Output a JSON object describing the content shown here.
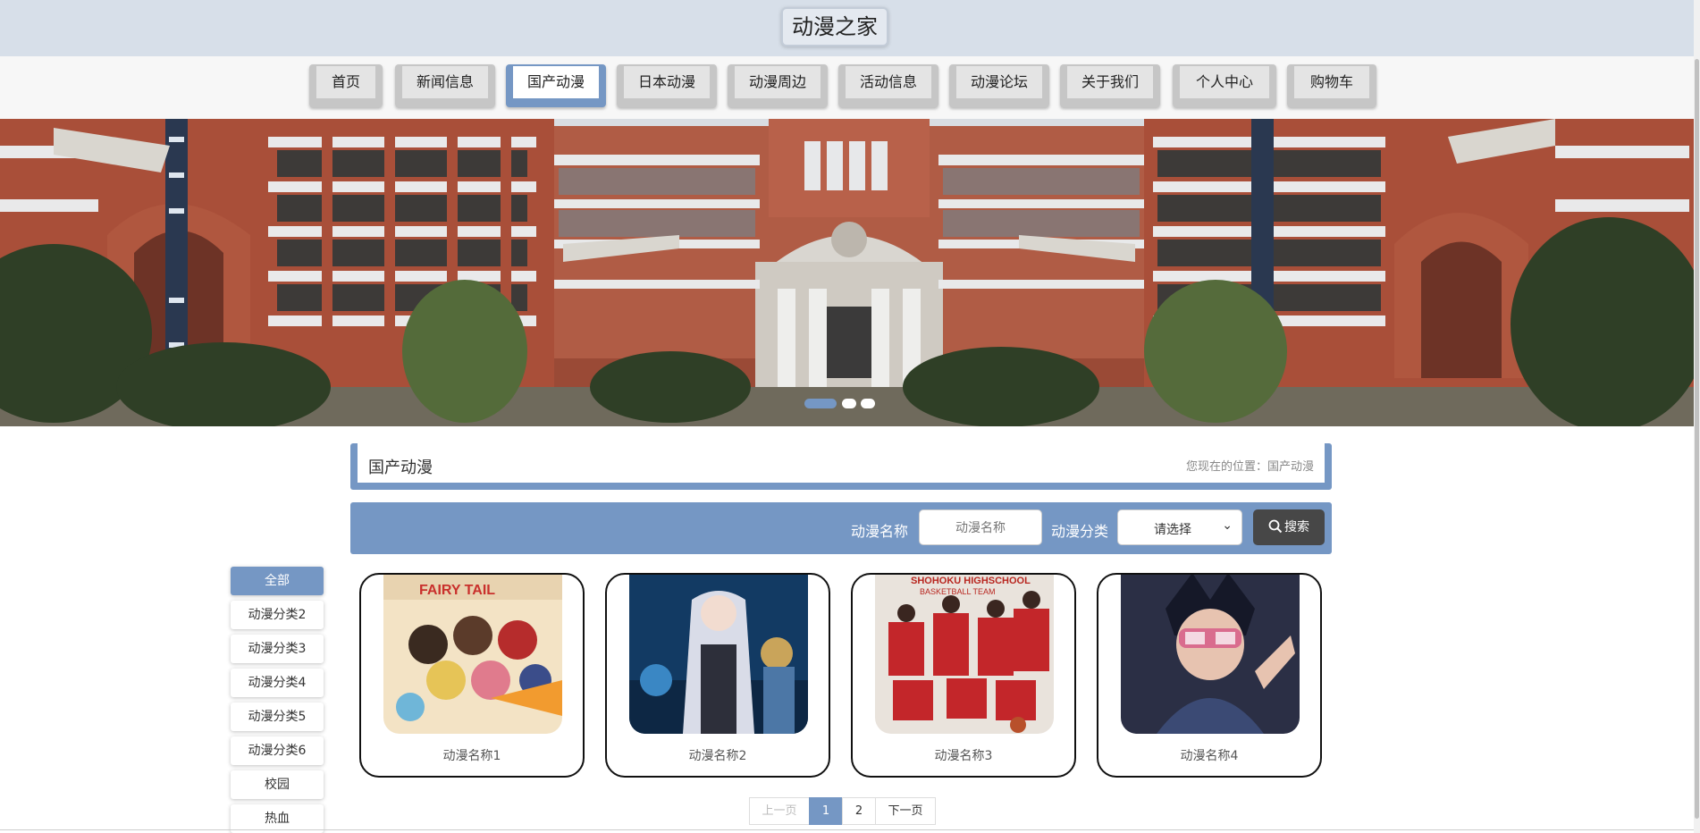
{
  "site": {
    "title": "动漫之家"
  },
  "nav": {
    "items": [
      {
        "label": "首页",
        "active": false
      },
      {
        "label": "新闻信息",
        "active": false
      },
      {
        "label": "国产动漫",
        "active": true
      },
      {
        "label": "日本动漫",
        "active": false
      },
      {
        "label": "动漫周边",
        "active": false
      },
      {
        "label": "活动信息",
        "active": false
      },
      {
        "label": "动漫论坛",
        "active": false
      },
      {
        "label": "关于我们",
        "active": false
      },
      {
        "label": "个人中心",
        "active": false
      },
      {
        "label": "购物车",
        "active": false
      }
    ]
  },
  "banner": {
    "slide_count": 3,
    "active_slide": 1
  },
  "breadcrumb": {
    "title": "国产动漫",
    "location": "您现在的位置：国产动漫"
  },
  "search": {
    "name_label": "动漫名称",
    "name_placeholder": "动漫名称",
    "category_label": "动漫分类",
    "category_selected": "请选择",
    "button_label": "搜索"
  },
  "categories": [
    "全部",
    "动漫分类2",
    "动漫分类3",
    "动漫分类4",
    "动漫分类5",
    "动漫分类6",
    "校园",
    "热血"
  ],
  "products": [
    {
      "name": "动漫名称1"
    },
    {
      "name": "动漫名称2"
    },
    {
      "name": "动漫名称3"
    },
    {
      "name": "动漫名称4"
    }
  ],
  "pagination": {
    "prev": "上一页",
    "pages": [
      "1",
      "2"
    ],
    "current": "1",
    "next": "下一页"
  },
  "colors": {
    "accent": "#7597c4",
    "header_bg": "#d7dfe9",
    "search_btn": "#474747"
  }
}
